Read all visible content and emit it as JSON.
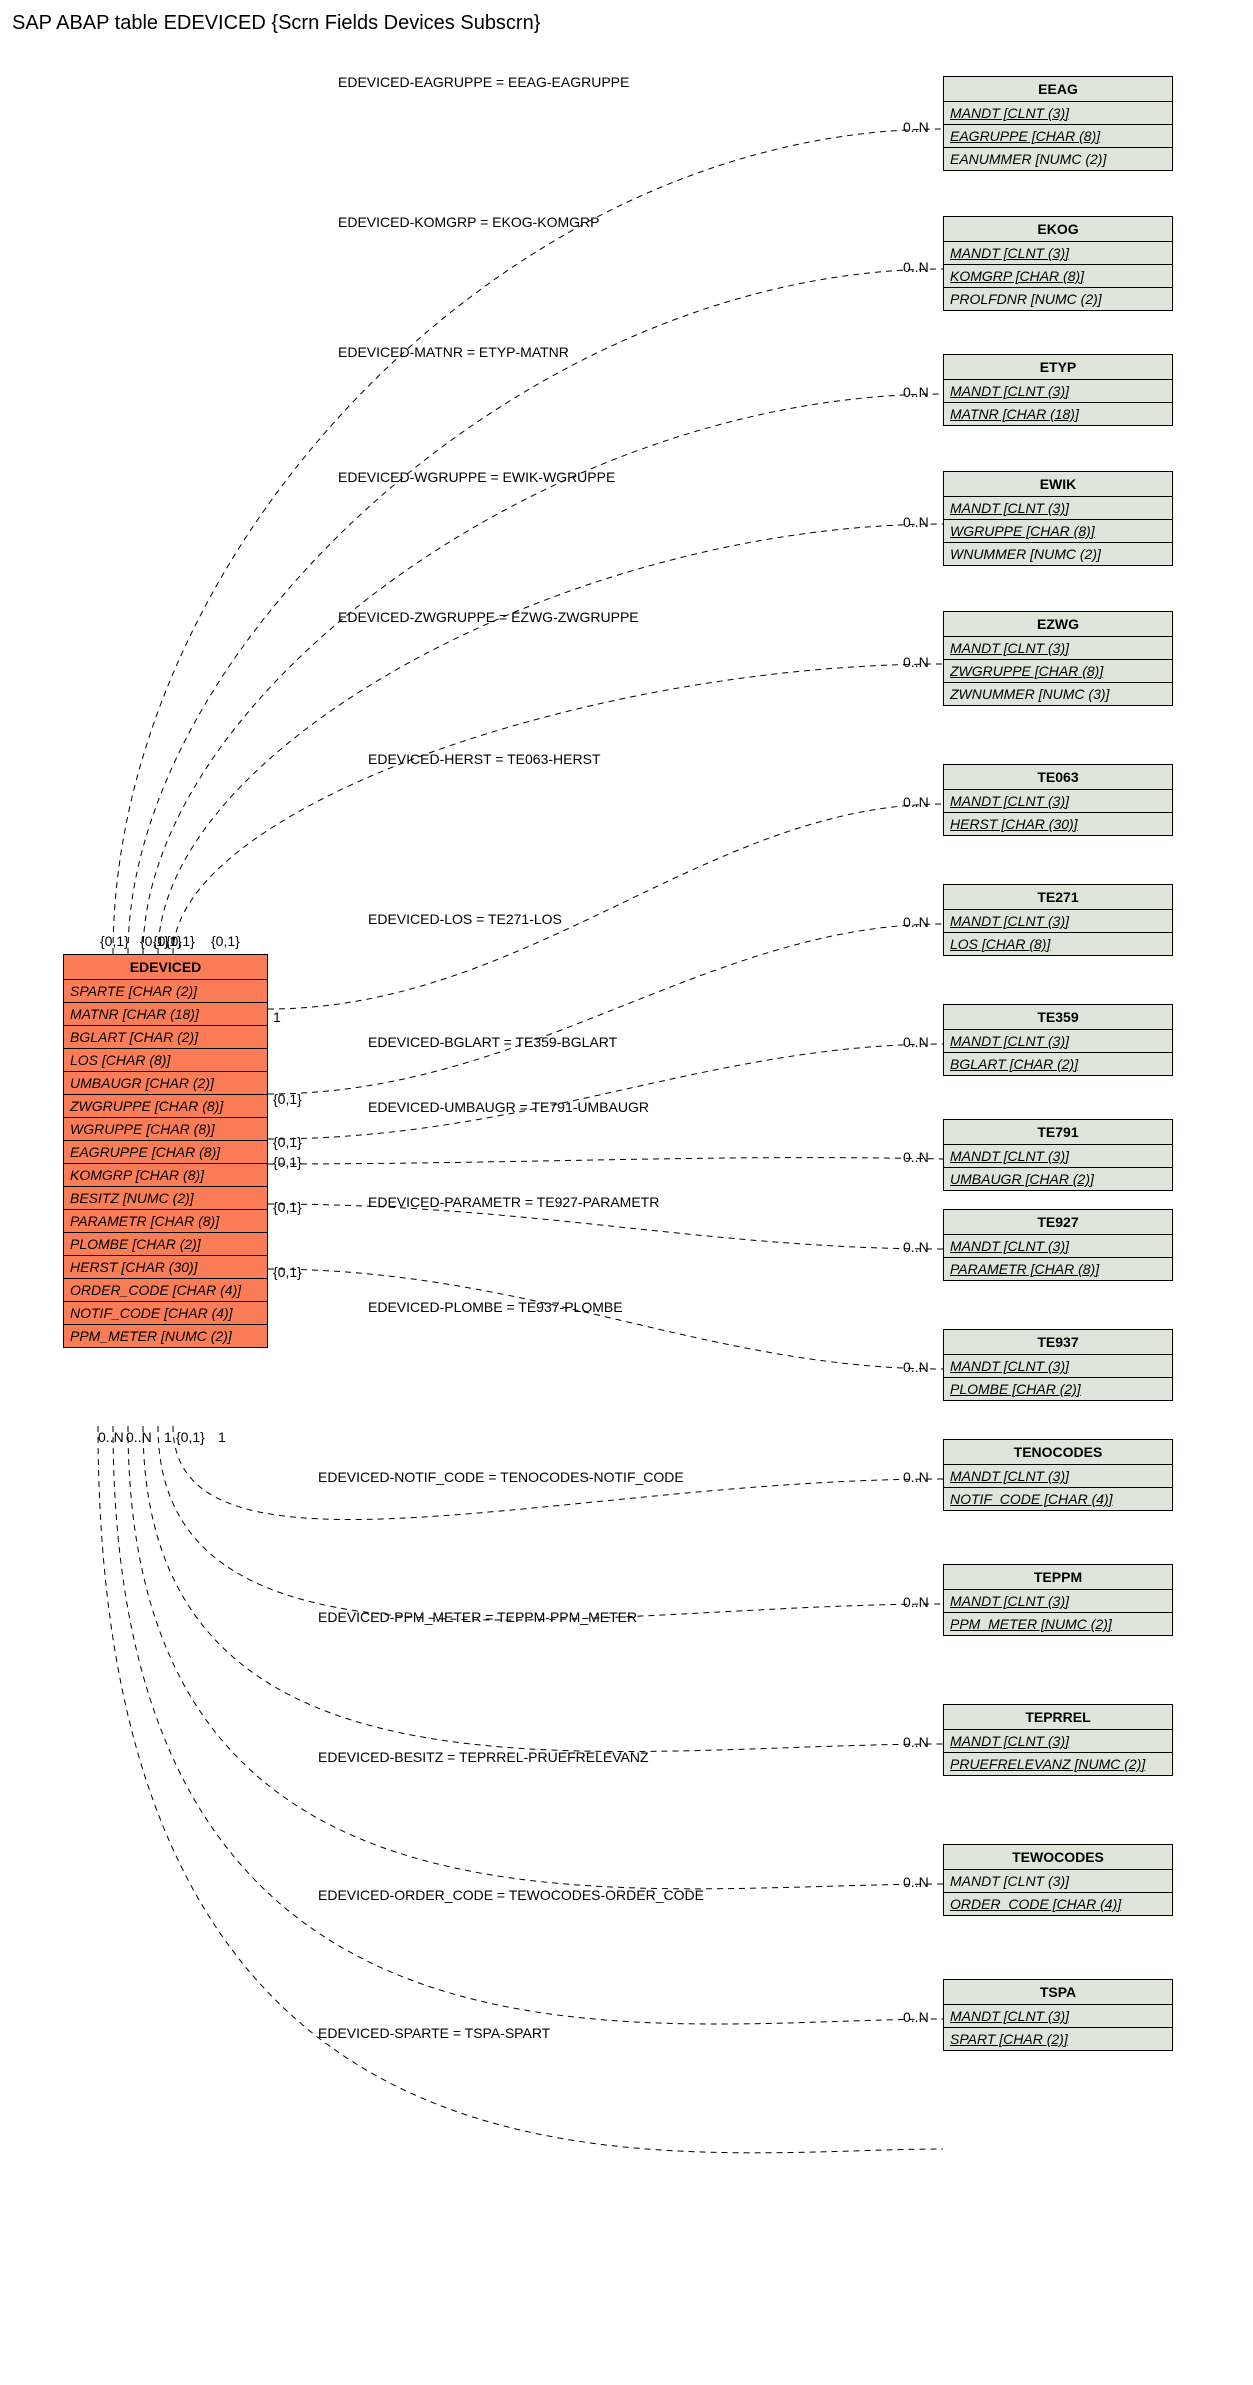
{
  "title": "SAP ABAP table EDEVICED {Scrn Fields Devices Subscrn}",
  "source": {
    "name": "EDEVICED",
    "fields": [
      "SPARTE [CHAR (2)]",
      "MATNR [CHAR (18)]",
      "BGLART [CHAR (2)]",
      "LOS [CHAR (8)]",
      "UMBAUGR [CHAR (2)]",
      "ZWGRUPPE [CHAR (8)]",
      "WGRUPPE [CHAR (8)]",
      "EAGRUPPE [CHAR (8)]",
      "KOMGRP [CHAR (8)]",
      "BESITZ [NUMC (2)]",
      "PARAMETR [CHAR (8)]",
      "PLOMBE [CHAR (2)]",
      "HERST [CHAR (30)]",
      "ORDER_CODE [CHAR (4)]",
      "NOTIF_CODE [CHAR (4)]",
      "PPM_METER [NUMC (2)]"
    ]
  },
  "targets": [
    {
      "name": "EEAG",
      "fields": [
        "MANDT [CLNT (3)]",
        "EAGRUPPE [CHAR (8)]",
        "EANUMMER [NUMC (2)]"
      ],
      "u": [
        0,
        1
      ],
      "label": "EDEVICED-EAGRUPPE = EEAG-EAGRUPPE"
    },
    {
      "name": "EKOG",
      "fields": [
        "MANDT [CLNT (3)]",
        "KOMGRP [CHAR (8)]",
        "PROLFDNR [NUMC (2)]"
      ],
      "u": [
        0,
        1
      ],
      "label": "EDEVICED-KOMGRP = EKOG-KOMGRP"
    },
    {
      "name": "ETYP",
      "fields": [
        "MANDT [CLNT (3)]",
        "MATNR [CHAR (18)]"
      ],
      "u": [
        0,
        1
      ],
      "label": "EDEVICED-MATNR = ETYP-MATNR"
    },
    {
      "name": "EWIK",
      "fields": [
        "MANDT [CLNT (3)]",
        "WGRUPPE [CHAR (8)]",
        "WNUMMER [NUMC (2)]"
      ],
      "u": [
        0,
        1
      ],
      "label": "EDEVICED-WGRUPPE = EWIK-WGRUPPE"
    },
    {
      "name": "EZWG",
      "fields": [
        "MANDT [CLNT (3)]",
        "ZWGRUPPE [CHAR (8)]",
        "ZWNUMMER [NUMC (3)]"
      ],
      "u": [
        0,
        1
      ],
      "label": "EDEVICED-ZWGRUPPE = EZWG-ZWGRUPPE"
    },
    {
      "name": "TE063",
      "fields": [
        "MANDT [CLNT (3)]",
        "HERST [CHAR (30)]"
      ],
      "u": [
        0,
        1
      ],
      "label": "EDEVICED-HERST = TE063-HERST"
    },
    {
      "name": "TE271",
      "fields": [
        "MANDT [CLNT (3)]",
        "LOS [CHAR (8)]"
      ],
      "u": [
        0,
        1
      ],
      "label": "EDEVICED-LOS = TE271-LOS"
    },
    {
      "name": "TE359",
      "fields": [
        "MANDT [CLNT (3)]",
        "BGLART [CHAR (2)]"
      ],
      "u": [
        0,
        1
      ],
      "label": "EDEVICED-BGLART = TE359-BGLART"
    },
    {
      "name": "TE791",
      "fields": [
        "MANDT [CLNT (3)]",
        "UMBAUGR [CHAR (2)]"
      ],
      "u": [
        0,
        1
      ],
      "label": "EDEVICED-UMBAUGR = TE791-UMBAUGR"
    },
    {
      "name": "TE927",
      "fields": [
        "MANDT [CLNT (3)]",
        "PARAMETR [CHAR (8)]"
      ],
      "u": [
        0,
        1
      ],
      "label": "EDEVICED-PARAMETR = TE927-PARAMETR"
    },
    {
      "name": "TE937",
      "fields": [
        "MANDT [CLNT (3)]",
        "PLOMBE [CHAR (2)]"
      ],
      "u": [
        0,
        1
      ],
      "label": "EDEVICED-PLOMBE = TE937-PLOMBE"
    },
    {
      "name": "TENOCODES",
      "fields": [
        "MANDT [CLNT (3)]",
        "NOTIF_CODE [CHAR (4)]"
      ],
      "u": [
        0,
        1
      ],
      "label": "EDEVICED-NOTIF_CODE = TENOCODES-NOTIF_CODE"
    },
    {
      "name": "TEPPM",
      "fields": [
        "MANDT [CLNT (3)]",
        "PPM_METER [NUMC (2)]"
      ],
      "u": [
        0,
        1
      ],
      "label": "EDEVICED-PPM_METER = TEPPM-PPM_METER"
    },
    {
      "name": "TEPRREL",
      "fields": [
        "MANDT [CLNT (3)]",
        "PRUEFRELEVANZ [NUMC (2)]"
      ],
      "u": [
        0,
        1
      ],
      "label": "EDEVICED-BESITZ = TEPRREL-PRUEFRELEVANZ"
    },
    {
      "name": "TEWOCODES",
      "fields": [
        "MANDT [CLNT (3)]",
        "ORDER_CODE [CHAR (4)]"
      ],
      "u": [
        1
      ],
      "label": "EDEVICED-ORDER_CODE = TEWOCODES-ORDER_CODE"
    },
    {
      "name": "TSPA",
      "fields": [
        "MANDT [CLNT (3)]",
        "SPART [CHAR (2)]"
      ],
      "u": [
        0,
        1
      ],
      "label": "EDEVICED-SPARTE = TSPA-SPART"
    }
  ],
  "src_cards_top": [
    "{0,1}",
    "{0,1}",
    "{0,1}",
    "{0,1}",
    "{0,1}"
  ],
  "src_cards_right": [
    "1",
    "{0,1}",
    "{0,1}",
    "{0,1}",
    "{0,1}",
    "{0,1}"
  ],
  "src_cards_bottom": [
    "0..N",
    "0..N",
    "1",
    "{0,1}",
    "1"
  ],
  "tgt_card": "0..N"
}
